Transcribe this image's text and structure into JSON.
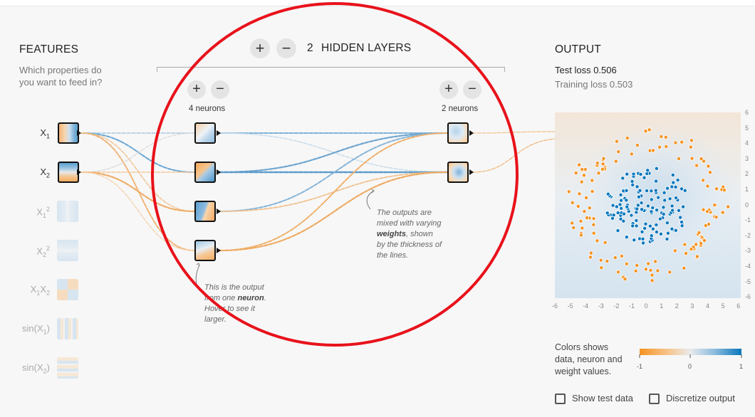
{
  "features": {
    "title": "FEATURES",
    "subtitle_l1": "Which properties do",
    "subtitle_l2": "you want to feed in?",
    "items": [
      {
        "base": "X",
        "sub": "1",
        "sup": "",
        "active": true
      },
      {
        "base": "X",
        "sub": "2",
        "sup": "",
        "active": true
      },
      {
        "base": "X",
        "sub": "1",
        "sup": "2",
        "active": false
      },
      {
        "base": "X",
        "sub": "2",
        "sup": "2",
        "active": false
      },
      {
        "base": "X",
        "sub": "1",
        "sup": "",
        "base2": "X",
        "sub2": "2",
        "active": false
      },
      {
        "base": "sin(X",
        "sub": "1",
        "sup": "",
        "tail": ")",
        "active": false
      },
      {
        "base": "sin(X",
        "sub": "2",
        "sup": "",
        "tail": ")",
        "active": false
      }
    ]
  },
  "hidden": {
    "add_layer": "+",
    "remove_layer": "−",
    "count": "2",
    "label": "HIDDEN LAYERS",
    "layers": [
      {
        "add": "+",
        "remove": "−",
        "neurons_label": "4 neurons"
      },
      {
        "add": "+",
        "remove": "−",
        "neurons_label": "2 neurons"
      }
    ]
  },
  "notes": {
    "neuron_note": [
      "This is the output",
      "from one ",
      "neuron",
      ".",
      "Hover to see it",
      "larger."
    ],
    "weights_note": [
      "The outputs are",
      "mixed with varying",
      "weights",
      ", shown",
      "by the thickness of",
      "the lines."
    ]
  },
  "output": {
    "title": "OUTPUT",
    "test_loss_label": "Test loss",
    "test_loss": "0.506",
    "training_loss_label": "Training loss",
    "training_loss": "0.503",
    "axis_ticks": [
      "-6",
      "-5",
      "-4",
      "-3",
      "-2",
      "-1",
      "0",
      "1",
      "2",
      "3",
      "4",
      "5",
      "6"
    ],
    "yaxis_ticks": [
      "6",
      "5",
      "4",
      "3",
      "2",
      "1",
      "0",
      "-1",
      "-2",
      "-3",
      "-4",
      "-5",
      "-6"
    ],
    "legend_l1": "Colors shows",
    "legend_l2": "data, neuron and",
    "legend_l3": "weight values.",
    "legend_min": "-1",
    "legend_mid": "0",
    "legend_max": "1",
    "show_test_data": "Show test data",
    "discretize_output": "Discretize output"
  },
  "colors": {
    "orange": "#f59322",
    "blue": "#0877bd",
    "annotation": "#e8121b"
  }
}
